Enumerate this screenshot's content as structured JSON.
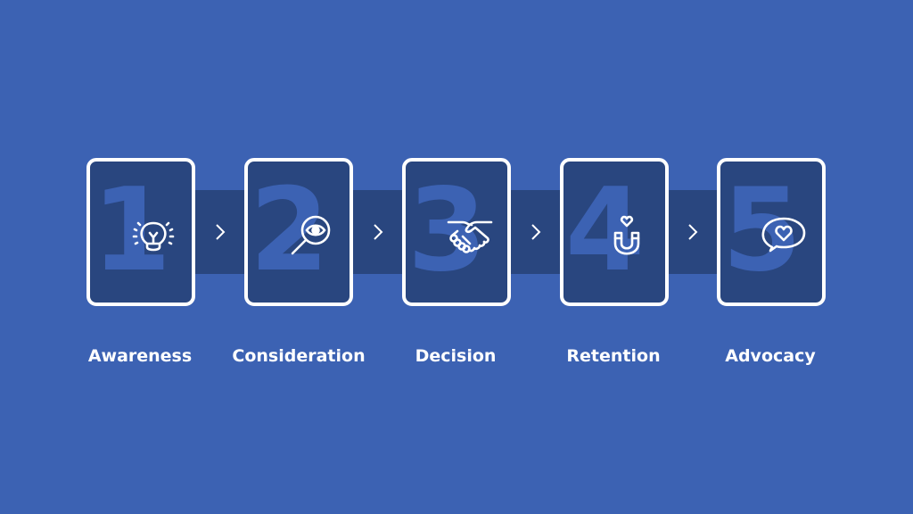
{
  "colors": {
    "background": "#3c62b3",
    "band": "#29467f",
    "card_border": "#ffffff"
  },
  "steps": [
    {
      "number": "1",
      "label": "Awareness",
      "icon": "lightbulb-icon"
    },
    {
      "number": "2",
      "label": "Consideration",
      "icon": "magnifier-eye-icon"
    },
    {
      "number": "3",
      "label": "Decision",
      "icon": "handshake-icon"
    },
    {
      "number": "4",
      "label": "Retention",
      "icon": "magnet-heart-icon"
    },
    {
      "number": "5",
      "label": "Advocacy",
      "icon": "speech-bubble-heart-icon"
    }
  ]
}
